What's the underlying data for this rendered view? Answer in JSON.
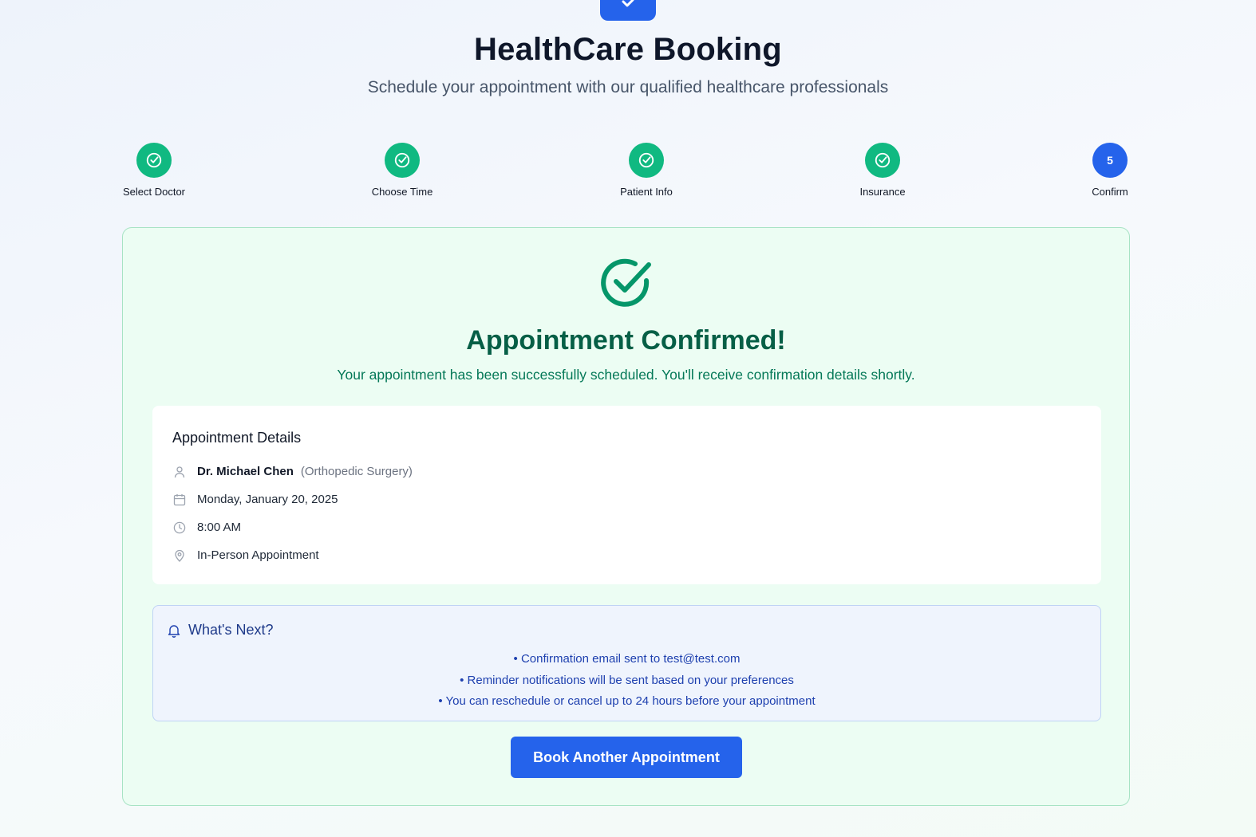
{
  "header": {
    "title": "HealthCare Booking",
    "subtitle": "Schedule your appointment with our qualified healthcare professionals"
  },
  "steps": [
    {
      "label": "Select Doctor",
      "status": "completed"
    },
    {
      "label": "Choose Time",
      "status": "completed"
    },
    {
      "label": "Patient Info",
      "status": "completed"
    },
    {
      "label": "Insurance",
      "status": "completed"
    },
    {
      "label": "Confirm",
      "status": "current",
      "number": "5"
    }
  ],
  "confirmation": {
    "title": "Appointment Confirmed!",
    "message": "Your appointment has been successfully scheduled. You'll receive confirmation details shortly."
  },
  "details": {
    "heading": "Appointment Details",
    "doctor_name": "Dr. Michael Chen",
    "specialty": "(Orthopedic Surgery)",
    "date": "Monday, January 20, 2025",
    "time": "8:00 AM",
    "type": "In-Person Appointment"
  },
  "whats_next": {
    "heading": "What's Next?",
    "items": [
      "• Confirmation email sent to test@test.com",
      "• Reminder notifications will be sent based on your preferences",
      "• You can reschedule or cancel up to 24 hours before your appointment"
    ]
  },
  "actions": {
    "book_another_label": "Book Another Appointment"
  },
  "colors": {
    "primary": "#2563eb",
    "success": "#10b981",
    "success_dark": "#065f46",
    "info_text": "#1e40af"
  },
  "icons": {
    "logo": "check-icon",
    "completed_step": "check-circle-icon",
    "doctor": "user-icon",
    "date": "calendar-icon",
    "time": "clock-icon",
    "type": "map-pin-icon",
    "whats_next": "bell-icon"
  }
}
